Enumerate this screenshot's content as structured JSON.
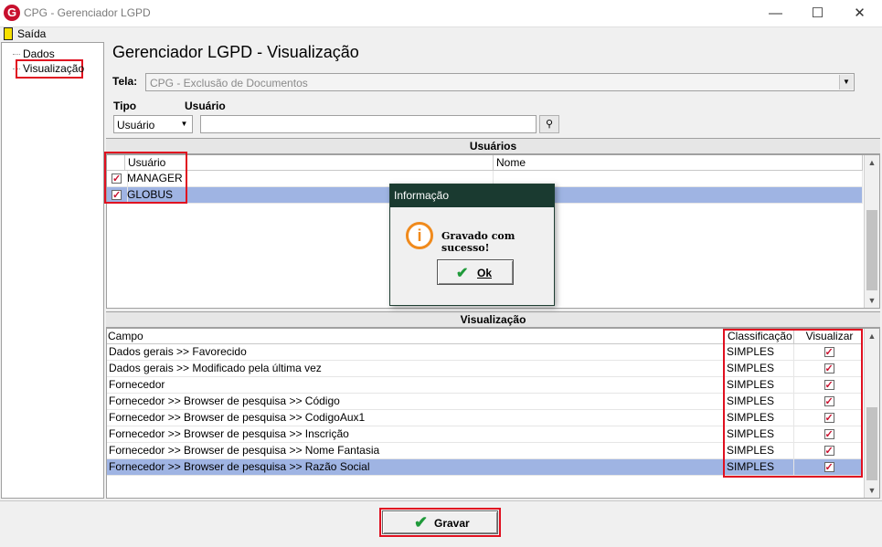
{
  "window": {
    "logo_letter": "G",
    "title": "CPG - Gerenciador LGPD",
    "minimize": "—",
    "maximize": "☐",
    "close": "✕"
  },
  "menu": {
    "exit_label": "Saída"
  },
  "tree": {
    "items": [
      {
        "label": "Dados"
      },
      {
        "label": "Visualização"
      }
    ]
  },
  "header": {
    "title": "Gerenciador LGPD - Visualização",
    "screen_label": "Tela:",
    "screen_value": "CPG - Exclusão de Documentos",
    "type_label": "Tipo",
    "type_value": "Usuário",
    "user_label": "Usuário",
    "user_value": ""
  },
  "users": {
    "section_title": "Usuários",
    "columns": [
      "Usuário",
      "Nome"
    ],
    "rows": [
      {
        "checked": true,
        "user": "MANAGER",
        "name": ""
      },
      {
        "checked": true,
        "user": "GLOBUS",
        "name": ""
      }
    ]
  },
  "view": {
    "section_title": "Visualização",
    "columns": [
      "Campo",
      "Classificação",
      "Visualizar"
    ],
    "rows": [
      {
        "field": "Dados gerais >> Favorecido",
        "class": "SIMPLES",
        "visible": true
      },
      {
        "field": "Dados gerais >> Modificado pela última vez",
        "class": "SIMPLES",
        "visible": true
      },
      {
        "field": "Fornecedor",
        "class": "SIMPLES",
        "visible": true
      },
      {
        "field": "Fornecedor >> Browser de pesquisa >> Código",
        "class": "SIMPLES",
        "visible": true
      },
      {
        "field": "Fornecedor >> Browser de pesquisa >> CodigoAux1",
        "class": "SIMPLES",
        "visible": true
      },
      {
        "field": "Fornecedor >> Browser de pesquisa >> Inscrição",
        "class": "SIMPLES",
        "visible": true
      },
      {
        "field": "Fornecedor >> Browser de pesquisa >> Nome Fantasia",
        "class": "SIMPLES",
        "visible": true
      },
      {
        "field": "Fornecedor >> Browser de pesquisa >> Razão Social",
        "class": "SIMPLES",
        "visible": true
      }
    ]
  },
  "dialog": {
    "title": "Informação",
    "icon": "i",
    "message": "Gravado com sucesso!",
    "ok_label": "Ok"
  },
  "footer": {
    "save_label": "Gravar"
  },
  "colors": {
    "highlight": "#e01020",
    "selection": "#9fb4e3",
    "dialog_title_bg": "#1a3a30"
  }
}
